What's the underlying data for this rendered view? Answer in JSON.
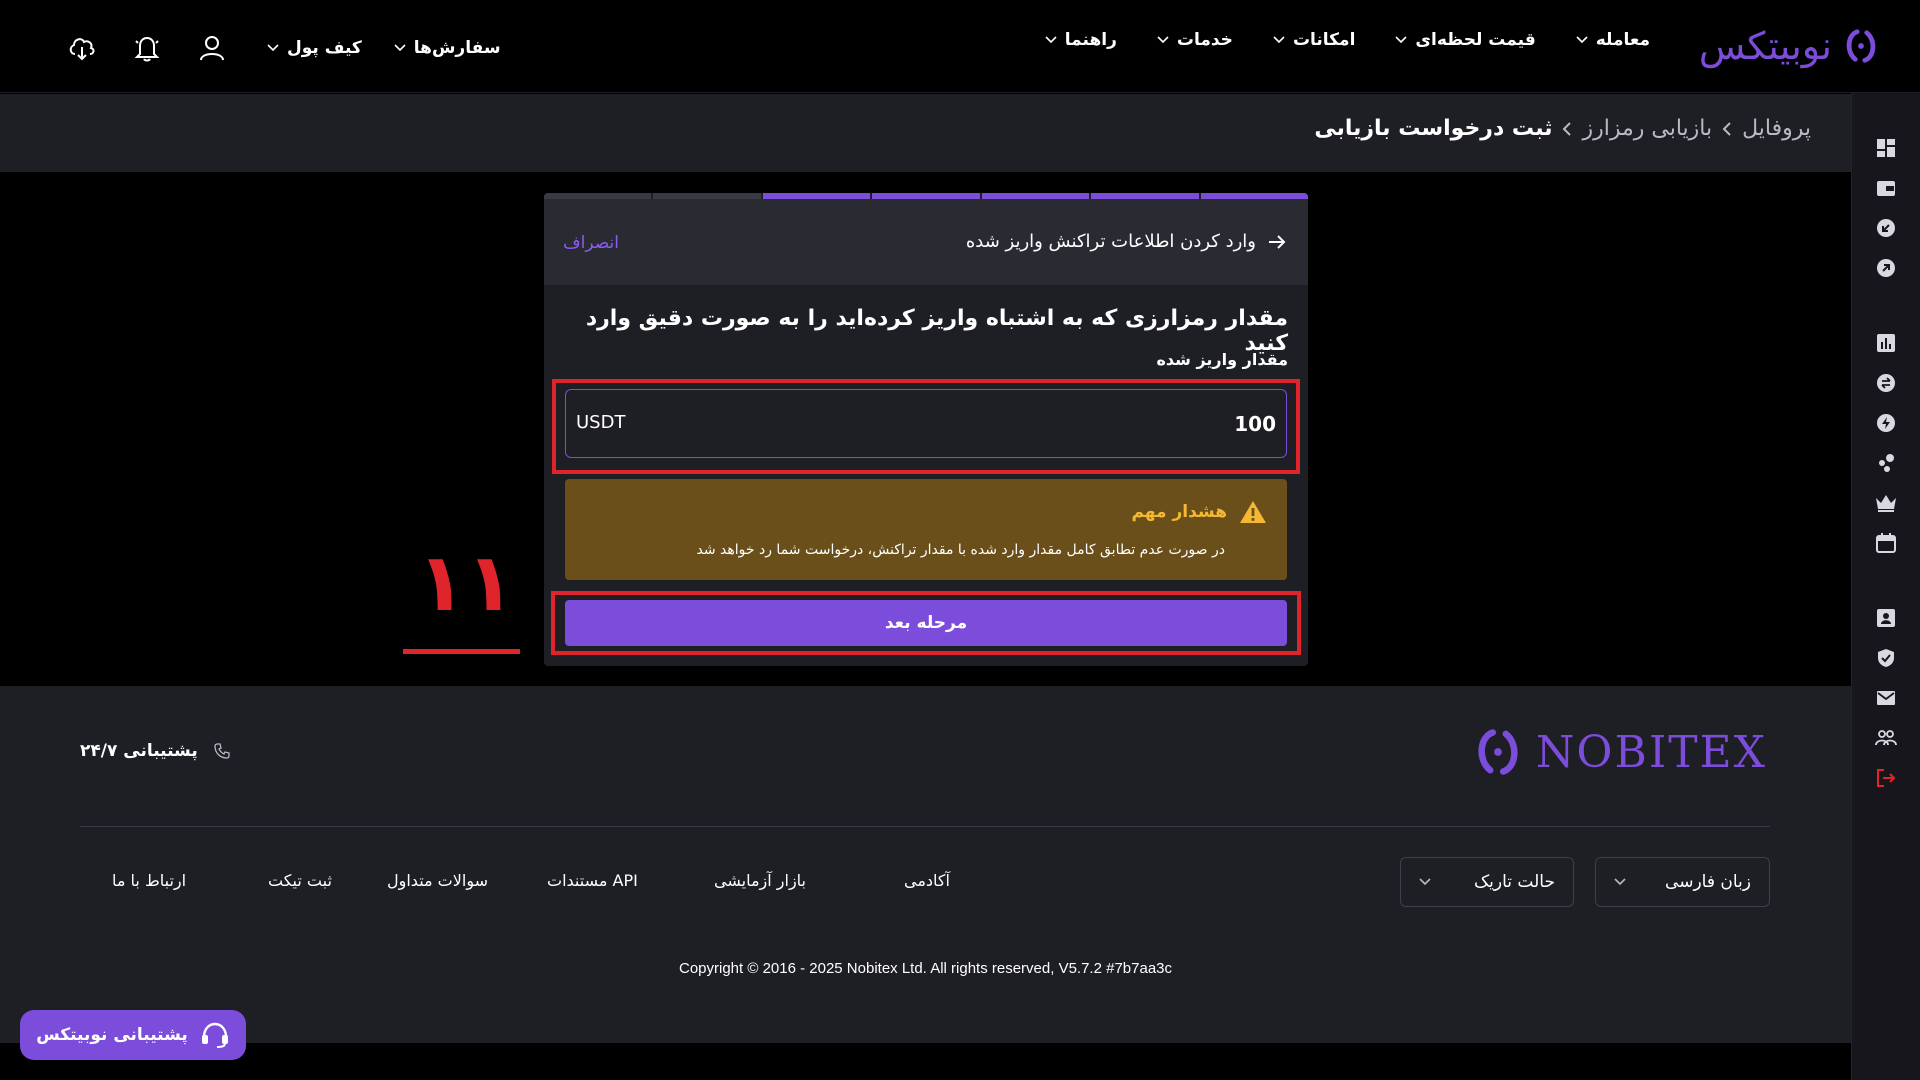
{
  "header": {
    "logo_text": "نوبیتکس",
    "nav": [
      {
        "label": "معامله"
      },
      {
        "label": "قیمت لحظه‌ای"
      },
      {
        "label": "امکانات"
      },
      {
        "label": "خدمات"
      },
      {
        "label": "راهنما"
      }
    ],
    "orders_label": "سفارش‌ها",
    "wallet_label": "کیف پول"
  },
  "breadcrumb": {
    "items": [
      "پروفایل",
      "بازیابی رمزارز"
    ],
    "current": "ثبت درخواست بازیابی"
  },
  "card": {
    "steps_total": 7,
    "steps_done": 5,
    "title": "وارد کردن اطلاعات تراکنش واریز شده",
    "cancel_label": "انصراف",
    "instruction": "مقدار رمزارزی که به اشتباه واریز کرده‌اید را به صورت دقیق وارد کنید",
    "field_label": "مقدار واریز شده",
    "amount_value": "100",
    "amount_unit": "USDT",
    "warning_title": "هشدار مهم",
    "warning_body": "در صورت عدم تطابق کامل مقدار وارد شده با مقدار تراکنش، درخواست شما رد خواهد شد",
    "next_label": "مرحله بعد"
  },
  "annotation": {
    "number": "۱۱"
  },
  "footer": {
    "logo_text": "NOBITEX",
    "support_label": "پشتیبانی ۲۴/۷",
    "links": [
      "ارتباط با ما",
      "ثبت تیکت",
      "سوالات متداول",
      "مستندات API",
      "بازار آزمایشی",
      "آکادمی"
    ],
    "theme_label": "حالت تاریک",
    "language_label": "زبان فارسی",
    "copyright": "Copyright © 2016 - 2025 Nobitex Ltd. All rights reserved, V5.7.2 #7b7aa3c"
  },
  "support_button": {
    "label": "پشتیبانی نوبیتکس"
  },
  "colors": {
    "accent": "#7c4ddb",
    "background": "#000000",
    "surface": "#1e1e25",
    "warning_bg": "#6a4f1b",
    "warning_text": "#f5b833",
    "highlight": "#e0242b"
  }
}
